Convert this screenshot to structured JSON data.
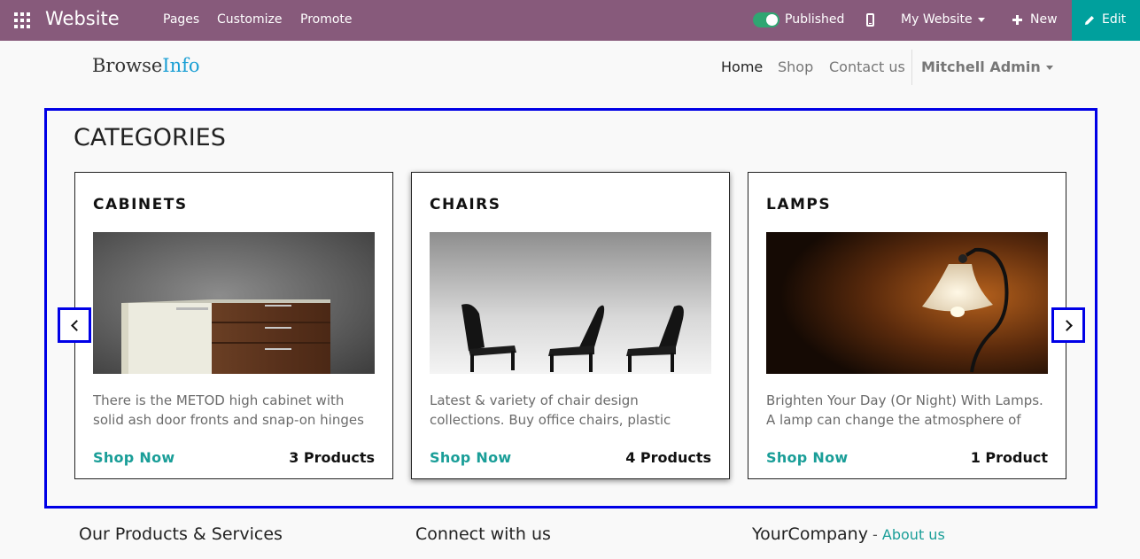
{
  "topbar": {
    "brand": "Website",
    "menu": [
      "Pages",
      "Customize",
      "Promote"
    ],
    "published_label": "Published",
    "published": true,
    "site_selector": "My Website",
    "new_label": "New",
    "edit_label": "Edit",
    "icons": {
      "apps": "apps-grid-icon",
      "device": "mobile-icon",
      "new": "plus-icon",
      "edit": "pencil-icon"
    }
  },
  "site": {
    "logo_part1": "Browse",
    "logo_part2": "Info",
    "nav": [
      "Home",
      "Shop",
      "Contact us"
    ],
    "user": "Mitchell Admin"
  },
  "categories": {
    "title": "CATEGORIES",
    "cards": [
      {
        "title": "CABINETS",
        "description": "There is the METOD high cabinet with solid ash door fronts and snap-on hinges",
        "shop_label": "Shop Now",
        "count": "3 Products",
        "image": "cabinet"
      },
      {
        "title": "CHAIRS",
        "description": "Latest & variety of chair design collections. Buy office chairs, plastic",
        "shop_label": "Shop Now",
        "count": "4 Products",
        "image": "chairs"
      },
      {
        "title": "LAMPS",
        "description": "Brighten Your Day (Or Night) With Lamps. A lamp can change the atmosphere of",
        "shop_label": "Shop Now",
        "count": "1 Product",
        "image": "lamp"
      }
    ],
    "icons": {
      "prev": "chevron-left-icon",
      "next": "chevron-right-icon"
    }
  },
  "footer": {
    "col1_title": "Our Products & Services",
    "col2_title": "Connect with us",
    "col3_title": "YourCompany",
    "col3_sep": " - ",
    "col3_link": "About us"
  },
  "colors": {
    "topbar": "#875a7b",
    "edit": "#00a09d",
    "accent": "#1a9e98",
    "highlight": "#0000e6",
    "logo_accent": "#1a9fd4"
  }
}
